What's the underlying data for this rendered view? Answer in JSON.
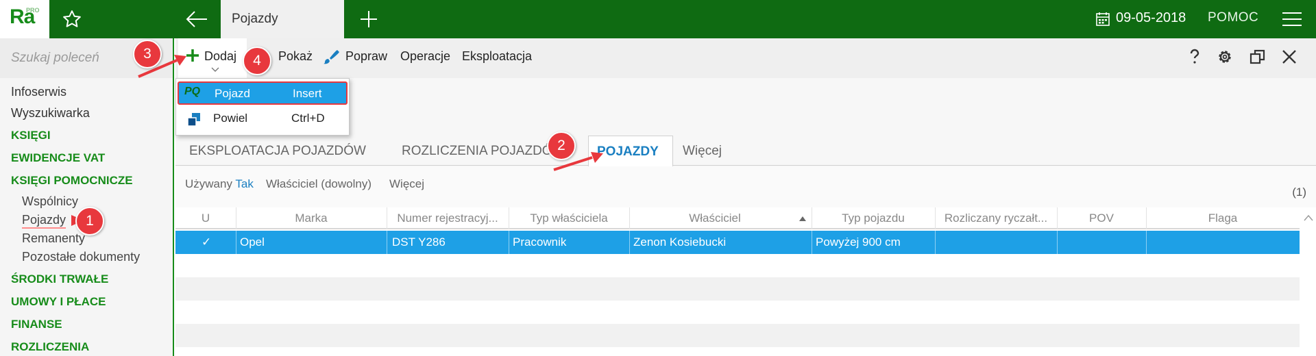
{
  "app": {
    "logo_text": "Ra",
    "logo_badge": "PRO",
    "active_tab": "Pojazdy",
    "date": "09-05-2018",
    "help_label": "POMOC"
  },
  "sidebar": {
    "search_placeholder": "Szukaj poleceń",
    "items": [
      {
        "label": "Infoserwis",
        "kind": "plain"
      },
      {
        "label": "Wyszukiwarka",
        "kind": "plain"
      },
      {
        "label": "KSIĘGI",
        "kind": "section"
      },
      {
        "label": "EWIDENCJE VAT",
        "kind": "section"
      },
      {
        "label": "KSIĘGI POMOCNICZE",
        "kind": "section"
      },
      {
        "label": "Wspólnicy",
        "kind": "sub"
      },
      {
        "label": "Pojazdy",
        "kind": "sub",
        "selected": true
      },
      {
        "label": "Remanenty",
        "kind": "sub"
      },
      {
        "label": "Pozostałe dokumenty",
        "kind": "sub"
      },
      {
        "label": "ŚRODKI TRWAŁE",
        "kind": "section"
      },
      {
        "label": "UMOWY I PŁACE",
        "kind": "section"
      },
      {
        "label": "FINANSE",
        "kind": "section"
      },
      {
        "label": "ROZLICZENIA",
        "kind": "section"
      }
    ]
  },
  "toolbar": {
    "add": "Dodaj",
    "show": "Pokaż",
    "edit": "Popraw",
    "operations": "Operacje",
    "exploitation": "Eksploatacja"
  },
  "dropdown": {
    "items": [
      {
        "icon": "PQ",
        "label": "Pojazd",
        "shortcut": "Insert",
        "selected": true
      },
      {
        "icon": "duplicate-icon",
        "label": "Powiel",
        "shortcut": "Ctrl+D",
        "selected": false
      }
    ]
  },
  "content_tabs": {
    "tab1": "EKSPLOATACJA POJAZDÓW",
    "tab2": "ROZLICZENIA POJAZDÓW",
    "tab3": "POJAZDY",
    "more": "Więcej"
  },
  "filters": {
    "used_label": "Używany",
    "used_value": "Tak",
    "owner": "Właściciel (dowolny)",
    "more": "Więcej",
    "count": "(1)"
  },
  "grid": {
    "columns": [
      "U",
      "Marka",
      "Numer rejestracyj...",
      "Typ właściciela",
      "Właściciel",
      "Typ pojazdu",
      "Rozliczany ryczałt...",
      "POV",
      "Flaga"
    ],
    "rows": [
      {
        "u": "✓",
        "marka": "Opel",
        "numer": "DST Y286",
        "typ_wlasciciela": "Pracownik",
        "wlasciciel": "Zenon Kosiebucki",
        "typ_pojazdu": "Powyżej 900 cm",
        "rozliczany": "",
        "pov": "",
        "flaga": ""
      }
    ]
  },
  "annotations": {
    "b1": "1",
    "b2": "2",
    "b3": "3",
    "b4": "4",
    "color": "#e8383d"
  },
  "colors": {
    "brand_green": "#0f6b12",
    "accent_green": "#178c1a",
    "selection_blue": "#1ea0e6",
    "link_blue": "#1a7fc1"
  }
}
